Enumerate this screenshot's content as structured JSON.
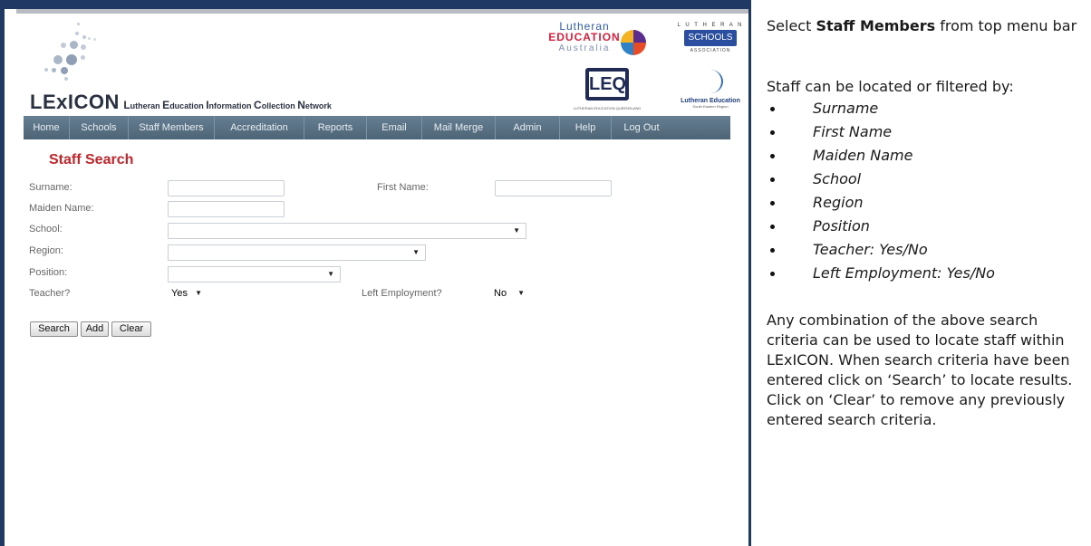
{
  "app": {
    "logo_main": "LExICON",
    "logo_tagline_parts": [
      "L",
      "utheran ",
      "E",
      "ducation ",
      "I",
      "nformation ",
      "C",
      "ollection ",
      "N",
      "etwork"
    ],
    "partner_logos": {
      "lea_line1": "Lutheran",
      "lea_line2": "EDUCATION",
      "lea_line3": "Australia",
      "lsa_top": "L U T H E R A N",
      "lsa_box": "SCHOOLS",
      "lsa_bottom": "ASSOCIATION",
      "leq_mark": "LEQ",
      "leq_sub": "LUTHERAN EDUCATION QUEENSLAND",
      "les_line1": "Lutheran Education",
      "les_line2": "South Eastern Region"
    }
  },
  "nav": {
    "items": [
      "Home",
      "Schools",
      "Staff Members",
      "Accreditation",
      "Reports",
      "Email",
      "Mail Merge",
      "Admin",
      "Help",
      "Log Out"
    ]
  },
  "search_form": {
    "title": "Staff Search",
    "surname_label": "Surname:",
    "first_name_label": "First Name:",
    "maiden_name_label": "Maiden Name:",
    "school_label": "School:",
    "region_label": "Region:",
    "position_label": "Position:",
    "teacher_label": "Teacher?",
    "teacher_value": "Yes",
    "left_employment_label": "Left Employment?",
    "left_employment_value": "No",
    "buttons": {
      "search": "Search",
      "add": "Add",
      "clear": "Clear"
    }
  },
  "instructions": {
    "intro_prefix": "Select ",
    "intro_bold": "Staff Members",
    "intro_suffix": " from top menu bar",
    "filter_intro": "Staff can be located or filtered by:",
    "filters": [
      "Surname",
      "First Name",
      "Maiden Name",
      "School",
      "Region",
      "Position",
      "Teacher: Yes/No",
      "Left Employment: Yes/No"
    ],
    "closing": "Any combination of the above search criteria can be used to locate staff within LExICON. When search criteria have been entered click on ‘Search’ to locate results. Click on ‘Clear’ to remove any previously entered search criteria."
  },
  "colors": {
    "frame": "#1f3864",
    "nav": "#5a7284",
    "title": "#c0272d"
  },
  "icons": {
    "dropdown": "chevron-down-icon"
  }
}
